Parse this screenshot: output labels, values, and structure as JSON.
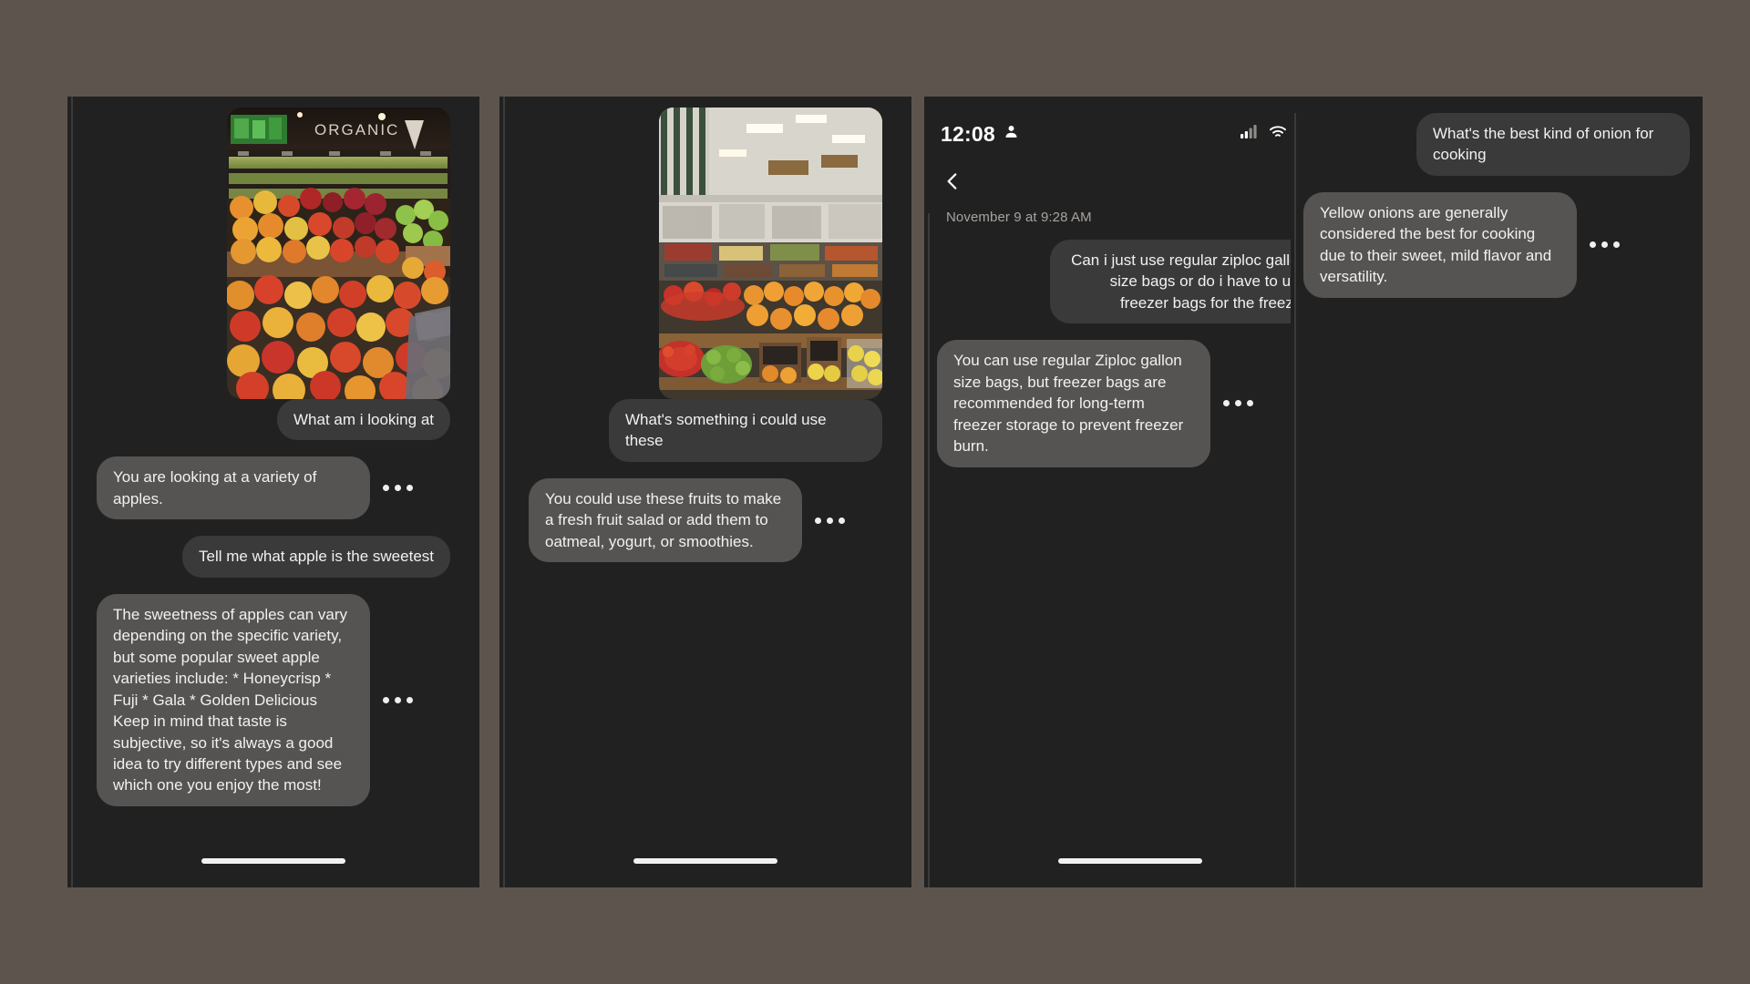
{
  "theme": {
    "canvas_bg": "#5d544e",
    "screen_bg": "#212121",
    "bubble_out_bg": "#3a3a3a",
    "bubble_in_bg": "#565452",
    "text_color": "#f2f1ef",
    "muted_text": "#a7a39f"
  },
  "panels": [
    {
      "id": "panel-1",
      "photo": {
        "alt": "organic-produce-apples-display",
        "sign_text": "ORGANIC"
      },
      "messages": [
        {
          "role": "user",
          "text": "What am i looking at",
          "has_menu": false
        },
        {
          "role": "assistant",
          "text": "You are looking at a variety of apples.",
          "has_menu": true
        },
        {
          "role": "user",
          "text": "Tell me what apple is the sweetest",
          "has_menu": false
        },
        {
          "role": "assistant",
          "text": "The sweetness of apples can vary depending on the specific variety, but some popular sweet apple varieties include: * Honeycrisp * Fuji * Gala * Golden Delicious Keep in mind that taste is subjective, so it's always a good idea to try different types and see which one you enjoy the most!",
          "has_menu": true
        }
      ]
    },
    {
      "id": "panel-2",
      "photo": {
        "alt": "grocery-store-produce-aisle-fruit",
        "sign_text": ""
      },
      "messages": [
        {
          "role": "user",
          "text": "What's something i could use these",
          "has_menu": false
        },
        {
          "role": "assistant",
          "text": "You could use these fruits to make a fresh fruit salad or add them to oatmeal, yogurt, or smoothies.",
          "has_menu": true
        }
      ]
    },
    {
      "id": "panel-3",
      "status_bar": {
        "time": "12:08",
        "person_icon": "person-icon",
        "signal_icon": "cellular-signal-icon",
        "wifi_icon": "wifi-icon",
        "battery_icon": "battery-icon"
      },
      "back_icon": "chevron-left-icon",
      "timestamp": "November 9 at 9:28 AM",
      "messages": [
        {
          "role": "user",
          "text": "Can i just use regular ziploc gallon size bags or do i have to use freezer bags for the freezer",
          "has_menu": false
        },
        {
          "role": "assistant",
          "text": "You can use regular Ziploc gallon size bags, but freezer bags are recommended for long-term freezer storage to prevent freezer burn.",
          "has_menu": true
        }
      ]
    },
    {
      "id": "panel-4",
      "messages": [
        {
          "role": "user",
          "text": "What's the best kind of onion for cooking",
          "has_menu": false
        },
        {
          "role": "assistant",
          "text": "Yellow onions are generally considered the best for cooking due to their sweet, mild flavor and versatility.",
          "has_menu": true
        }
      ]
    }
  ]
}
